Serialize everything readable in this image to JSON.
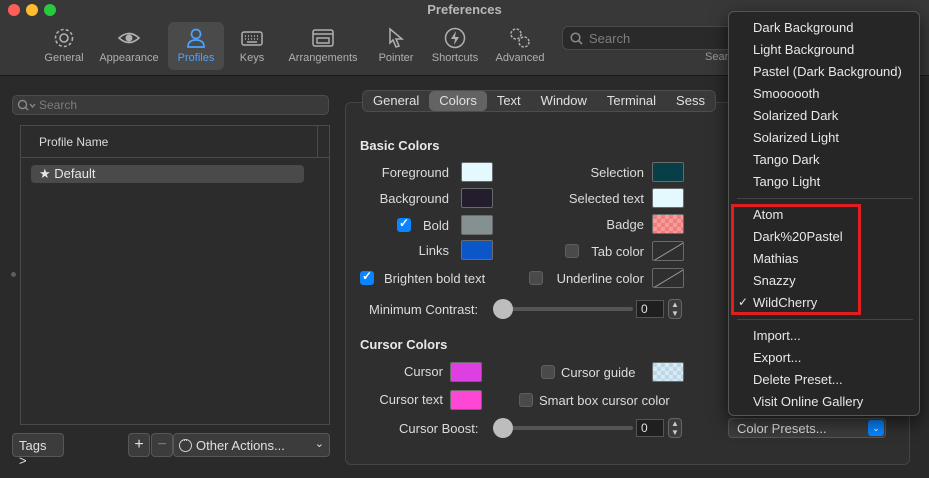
{
  "window": {
    "title": "Preferences"
  },
  "toolbar": {
    "items": [
      {
        "label": "General",
        "icon": "gear-icon"
      },
      {
        "label": "Appearance",
        "icon": "eye-icon"
      },
      {
        "label": "Profiles",
        "icon": "person-icon"
      },
      {
        "label": "Keys",
        "icon": "keyboard-icon"
      },
      {
        "label": "Arrangements",
        "icon": "window-icon"
      },
      {
        "label": "Pointer",
        "icon": "cursor-icon"
      },
      {
        "label": "Shortcuts",
        "icon": "bolt-icon"
      },
      {
        "label": "Advanced",
        "icon": "gears-icon"
      }
    ],
    "active": "Profiles",
    "search_placeholder": "Search",
    "search_hint": "Sear"
  },
  "sidebar": {
    "search_placeholder": "Search",
    "column_header": "Profile Name",
    "profiles": [
      "★ Default"
    ],
    "tags_label": "Tags >",
    "add_label": "+",
    "remove_label": "−",
    "other_actions_label": "Other Actions...",
    "other_actions_chevron": "⌄"
  },
  "tabs": [
    "General",
    "Colors",
    "Text",
    "Window",
    "Terminal",
    "Sess"
  ],
  "active_tab": "Colors",
  "basic_colors": {
    "title": "Basic Colors",
    "foreground_label": "Foreground",
    "background_label": "Background",
    "bold_label": "Bold",
    "links_label": "Links",
    "brighten_label": "Brighten bold text",
    "selection_label": "Selection",
    "selected_text_label": "Selected text",
    "badge_label": "Badge",
    "tab_color_label": "Tab color",
    "underline_label": "Underline color",
    "min_contrast_label": "Minimum Contrast:",
    "min_contrast_value": "0",
    "min_contrast_level": 0,
    "bold_checked": true,
    "brighten_checked": true,
    "tab_color_checked": false,
    "underline_checked": false,
    "colors": {
      "foreground": "#e3f9fd",
      "background": "#231d2d",
      "bold": "#849190",
      "links": "#0b56c9",
      "selection": "#083f47",
      "selected_text": "#e3f9fd",
      "badge": "#f07c7c"
    }
  },
  "cursor_colors": {
    "title": "Cursor Colors",
    "cursor_label": "Cursor",
    "cursor_text_label": "Cursor text",
    "cursor_guide_label": "Cursor guide",
    "smart_box_label": "Smart box cursor color",
    "boost_label": "Cursor Boost:",
    "boost_value": "0",
    "boost_level": 0,
    "cursor_guide_checked": false,
    "smart_box_checked": false,
    "colors": {
      "cursor": "#dd3fe3",
      "cursor_text": "#ff47d5",
      "cursor_guide": "#b9d7e8"
    }
  },
  "presets": {
    "button_label": "Color Presets...",
    "arrow": "⌄",
    "builtin": [
      "Dark Background",
      "Light Background",
      "Pastel (Dark Background)",
      "Smoooooth",
      "Solarized Dark",
      "Solarized Light",
      "Tango Dark",
      "Tango Light"
    ],
    "custom": [
      "Atom",
      "Dark%20Pastel",
      "Mathias",
      "Snazzy",
      "WildCherry"
    ],
    "selected": "WildCherry",
    "check_mark": "✓",
    "actions": [
      "Import...",
      "Export...",
      "Delete Preset...",
      "Visit Online Gallery"
    ]
  },
  "accent_colors": {
    "highlight": "#e01e1e",
    "selection_blue": "#0a84ff"
  }
}
